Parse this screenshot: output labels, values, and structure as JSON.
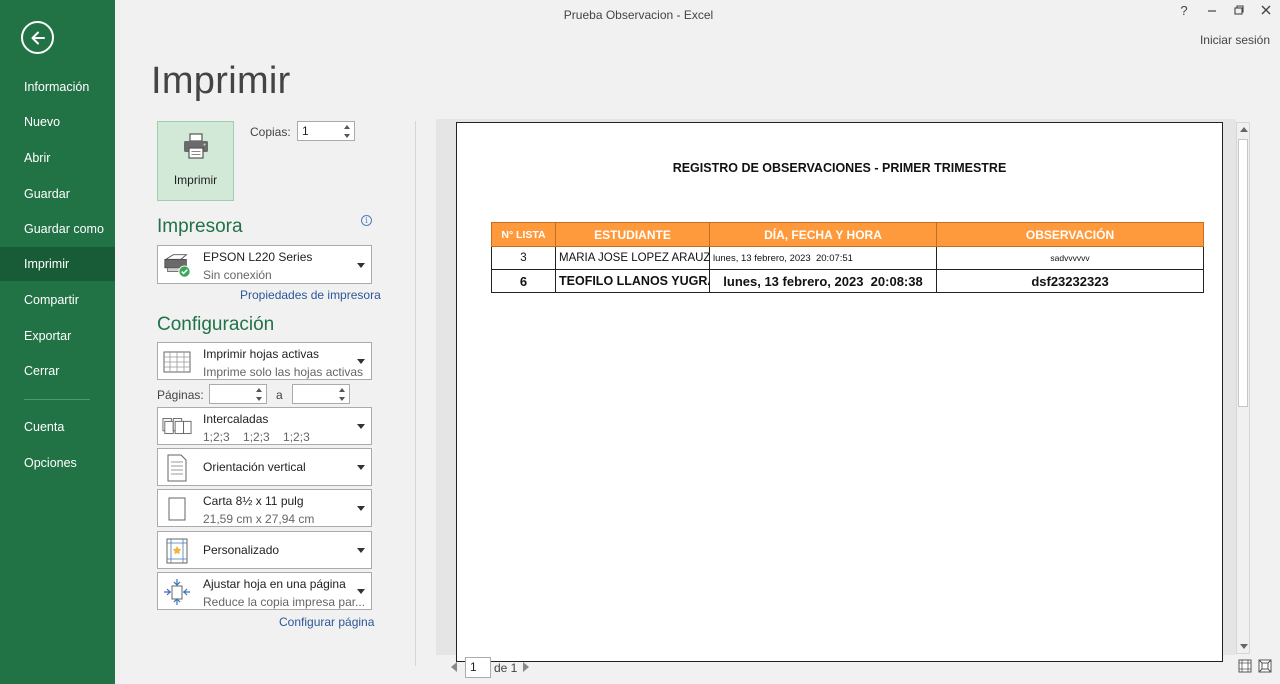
{
  "window": {
    "title": "Prueba Observacion - Excel",
    "help": "?",
    "signin": "Iniciar sesión"
  },
  "sidebar": {
    "items": [
      {
        "label": "Información"
      },
      {
        "label": "Nuevo"
      },
      {
        "label": "Abrir"
      },
      {
        "label": "Guardar"
      },
      {
        "label": "Guardar como"
      },
      {
        "label": "Imprimir",
        "active": true
      },
      {
        "label": "Compartir"
      },
      {
        "label": "Exportar"
      },
      {
        "label": "Cerrar"
      },
      {
        "label": "Cuenta"
      },
      {
        "label": "Opciones"
      }
    ]
  },
  "print": {
    "heading": "Imprimir",
    "button_label": "Imprimir",
    "copies_label": "Copias:",
    "copies_value": "1"
  },
  "printer": {
    "section": "Impresora",
    "name": "EPSON L220 Series",
    "status": "Sin conexión",
    "properties_link": "Propiedades de impresora"
  },
  "settings": {
    "section": "Configuración",
    "what": {
      "title": "Imprimir hojas activas",
      "subtitle": "Imprime solo las hojas activas"
    },
    "pages_label": "Páginas:",
    "pages_to": "a",
    "pages_from_value": "",
    "pages_to_value": "",
    "collate": {
      "title": "Intercaladas",
      "subtitle": "1;2;3    1;2;3    1;2;3"
    },
    "orientation": {
      "title": "Orientación vertical"
    },
    "paper": {
      "title": "Carta 8½ x 11 pulg",
      "subtitle": "21,59 cm x 27,94 cm"
    },
    "margins": {
      "title": "Personalizado"
    },
    "scaling": {
      "title": "Ajustar hoja en una página",
      "subtitle": "Reduce la copia impresa par..."
    },
    "page_setup_link": "Configurar página"
  },
  "preview": {
    "sheet_title": "REGISTRO DE OBSERVACIONES - PRIMER TRIMESTRE",
    "columns": [
      "N° LISTA",
      "ESTUDIANTE",
      "DÍA, FECHA Y HORA",
      "OBSERVACIÓN"
    ],
    "rows": [
      [
        "3",
        "MARIA JOSE LOPEZ ARAUZ",
        "lunes, 13 febrero, 2023  20:07:51",
        "sadvvvvvv"
      ],
      [
        "6",
        "TEOFILO LLANOS YUGRA",
        "lunes, 13 febrero, 2023  20:08:38",
        "dsf23232323"
      ]
    ],
    "header_color": "#ff9a3c",
    "page_current": "1",
    "page_total": "de 1"
  },
  "colors": {
    "sidebar": "#217346",
    "sidebar_active": "#185c37",
    "section_title": "#217346",
    "link": "#2b579a"
  }
}
